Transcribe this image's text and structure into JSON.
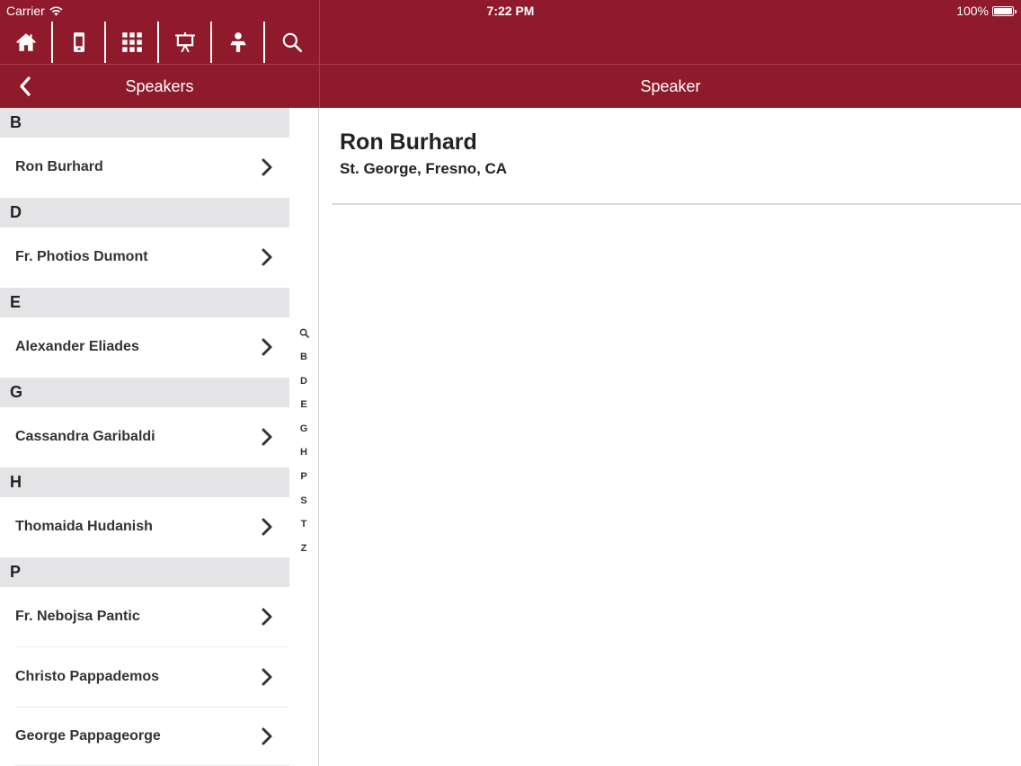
{
  "status_bar": {
    "carrier": "Carrier",
    "time": "7:22 PM",
    "battery": "100%"
  },
  "toolbar": {
    "items": [
      {
        "icon": "home-icon"
      },
      {
        "icon": "mobile-device-icon"
      },
      {
        "icon": "grid-icon"
      },
      {
        "icon": "presentation-icon"
      },
      {
        "icon": "speaker-person-icon"
      },
      {
        "icon": "search-icon"
      }
    ]
  },
  "nav": {
    "left_title": "Speakers",
    "right_title": "Speaker"
  },
  "list": {
    "sections": [
      {
        "letter": "B",
        "items": [
          "Ron Burhard"
        ]
      },
      {
        "letter": "D",
        "items": [
          "Fr. Photios Dumont"
        ]
      },
      {
        "letter": "E",
        "items": [
          "Alexander Eliades"
        ]
      },
      {
        "letter": "G",
        "items": [
          "Cassandra Garibaldi"
        ]
      },
      {
        "letter": "H",
        "items": [
          "Thomaida Hudanish"
        ]
      },
      {
        "letter": "P",
        "items": [
          "Fr. Nebojsa Pantic",
          "Christo Pappademos",
          "George Pappageorge"
        ]
      }
    ]
  },
  "index": {
    "letters": [
      "B",
      "D",
      "E",
      "G",
      "H",
      "P",
      "S",
      "T",
      "Z"
    ]
  },
  "detail": {
    "name": "Ron Burhard",
    "parish": "St. George, Fresno, CA"
  },
  "colors": {
    "brand": "#8f1a2c",
    "section_bg": "#e4e3e6"
  }
}
